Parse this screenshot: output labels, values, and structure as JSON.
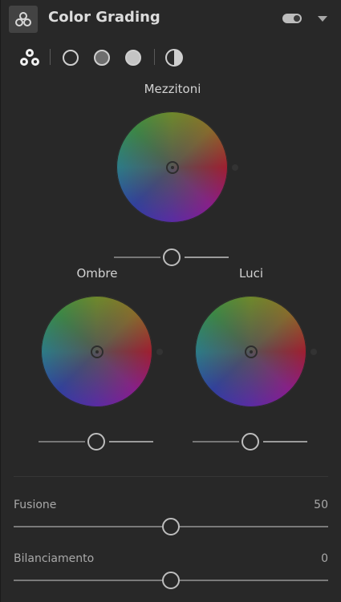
{
  "header": {
    "icon": "color-grading-icon",
    "title": "Color Grading",
    "toggle_state": "on"
  },
  "modes": [
    {
      "name": "three-way",
      "icon": "three-circles-icon",
      "selected": true
    },
    {
      "name": "shadows",
      "icon": "dark-circle-icon",
      "selected": false
    },
    {
      "name": "midtones",
      "icon": "gray-circle-icon",
      "selected": false
    },
    {
      "name": "highlights",
      "icon": "light-circle-icon",
      "selected": false
    },
    {
      "name": "global",
      "icon": "half-circle-icon",
      "selected": false
    }
  ],
  "wheels": {
    "midtones": {
      "label": "Mezzitoni",
      "luminance": 0.5
    },
    "shadows": {
      "label": "Ombre",
      "luminance": 0.5
    },
    "highlights": {
      "label": "Luci",
      "luminance": 0.5
    }
  },
  "sliders": {
    "blending": {
      "label": "Fusione",
      "value": "50",
      "fraction": 0.5
    },
    "balance": {
      "label": "Bilanciamento",
      "value": "0",
      "fraction": 0.5
    }
  },
  "colors": {
    "panel_bg": "#282828",
    "thumb": "#bdbdbd"
  }
}
